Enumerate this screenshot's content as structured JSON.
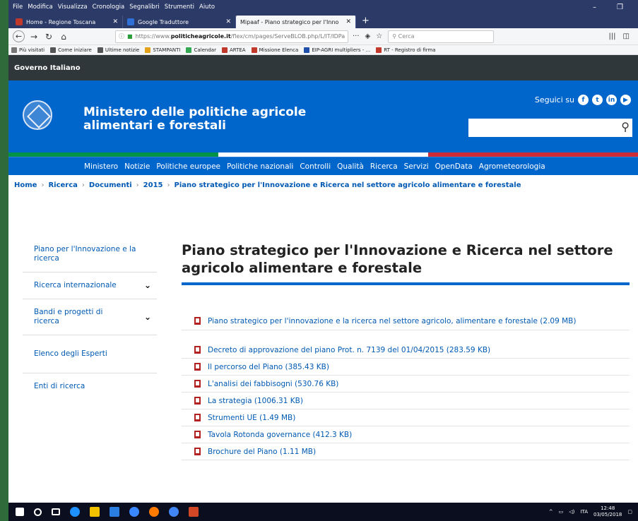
{
  "menu": [
    "File",
    "Modifica",
    "Visualizza",
    "Cronologia",
    "Segnalibri",
    "Strumenti",
    "Aiuto"
  ],
  "window_controls": {
    "minimize": "–",
    "restore": "❐"
  },
  "tabs": [
    {
      "label": "Home - Regione Toscana",
      "color": "#c0392b"
    },
    {
      "label": "Google Traduttore",
      "color": "#2f6fd6"
    },
    {
      "label": "Mipaaf - Piano strategico per l'Inno",
      "color": "#ffffff"
    }
  ],
  "new_tab": "+",
  "url": {
    "prefix": "https://www.",
    "domain": "politicheagricole.it",
    "path": "/flex/cm/pages/ServeBLOB.php/L/IT/IDPagina/"
  },
  "url_icons": [
    "···",
    "◈",
    "☆"
  ],
  "browser_search_placeholder": "Cerca",
  "bookmarks": [
    {
      "label": "Più visitati",
      "color": "#777777"
    },
    {
      "label": "Come iniziare",
      "color": "#555555"
    },
    {
      "label": "Ultime notizie",
      "color": "#555555"
    },
    {
      "label": "STAMPANTI",
      "color": "#e4a21b"
    },
    {
      "label": "Calendar",
      "color": "#34a853"
    },
    {
      "label": "ARTEA",
      "color": "#c0392b"
    },
    {
      "label": "Missione Elenca",
      "color": "#c0392b"
    },
    {
      "label": "EIP-AGRI multipliers - ...",
      "color": "#1f4fa8"
    },
    {
      "label": "RT - Registro di firma",
      "color": "#c0392b"
    }
  ],
  "gov_bar": "Governo Italiano",
  "ministry_line1": "Ministero delle politiche agricole",
  "ministry_line2": "alimentari e forestali",
  "follow_label": "Seguici su",
  "social_icons": [
    "f",
    "t",
    "in",
    "▶"
  ],
  "tricolor": [
    "#009246",
    "#ffffff",
    "#ce2b37"
  ],
  "main_nav": [
    "Ministero",
    "Notizie",
    "Politiche europee",
    "Politiche nazionali",
    "Controlli",
    "Qualità",
    "Ricerca",
    "Servizi",
    "OpenData",
    "Agrometeorologia"
  ],
  "breadcrumb": [
    "Home",
    "Ricerca",
    "Documenti",
    "2015",
    "Piano strategico per l'Innovazione e Ricerca nel settore agricolo alimentare e forestale"
  ],
  "sidebar": [
    {
      "label": "Piano per l'Innovazione e la ricerca",
      "chevron": ""
    },
    {
      "label": "Ricerca internazionale",
      "chevron": "⌄"
    },
    {
      "label": "Bandi e progetti di ricerca",
      "chevron": "⌄"
    },
    {
      "label": "Elenco degli Esperti",
      "chevron": ""
    },
    {
      "label": "Enti di ricerca",
      "chevron": ""
    }
  ],
  "page_title": "Piano strategico per l'Innovazione e Ricerca nel settore agricolo alimentare e forestale",
  "documents": [
    "Piano strategico per l'innovazione e la ricerca nel settore agricolo, alimentare e forestale (2.09 MB)",
    "Decreto di approvazione del piano Prot. n. 7139 del 01/04/2015 (283.59 KB)",
    "Il percorso del Piano (385.43 KB)",
    "L'analisi dei fabbisogni (530.76 KB)",
    "La strategia (1006.31 KB)",
    "Strumenti UE (1.49 MB)",
    "Tavola Rotonda governance (412.3 KB)",
    "Brochure del Piano (1.11 MB)"
  ],
  "taskbar_icons": [
    "#ffffff",
    "#ffffff",
    "#ffffff",
    "#1e90ff",
    "#f2c200",
    "#2a7de1",
    "#3a88ff",
    "#ff7a00",
    "#4285f4",
    "#d24726"
  ],
  "tray": {
    "lang": "ITA",
    "time": "12:48",
    "date": "03/05/2018"
  }
}
